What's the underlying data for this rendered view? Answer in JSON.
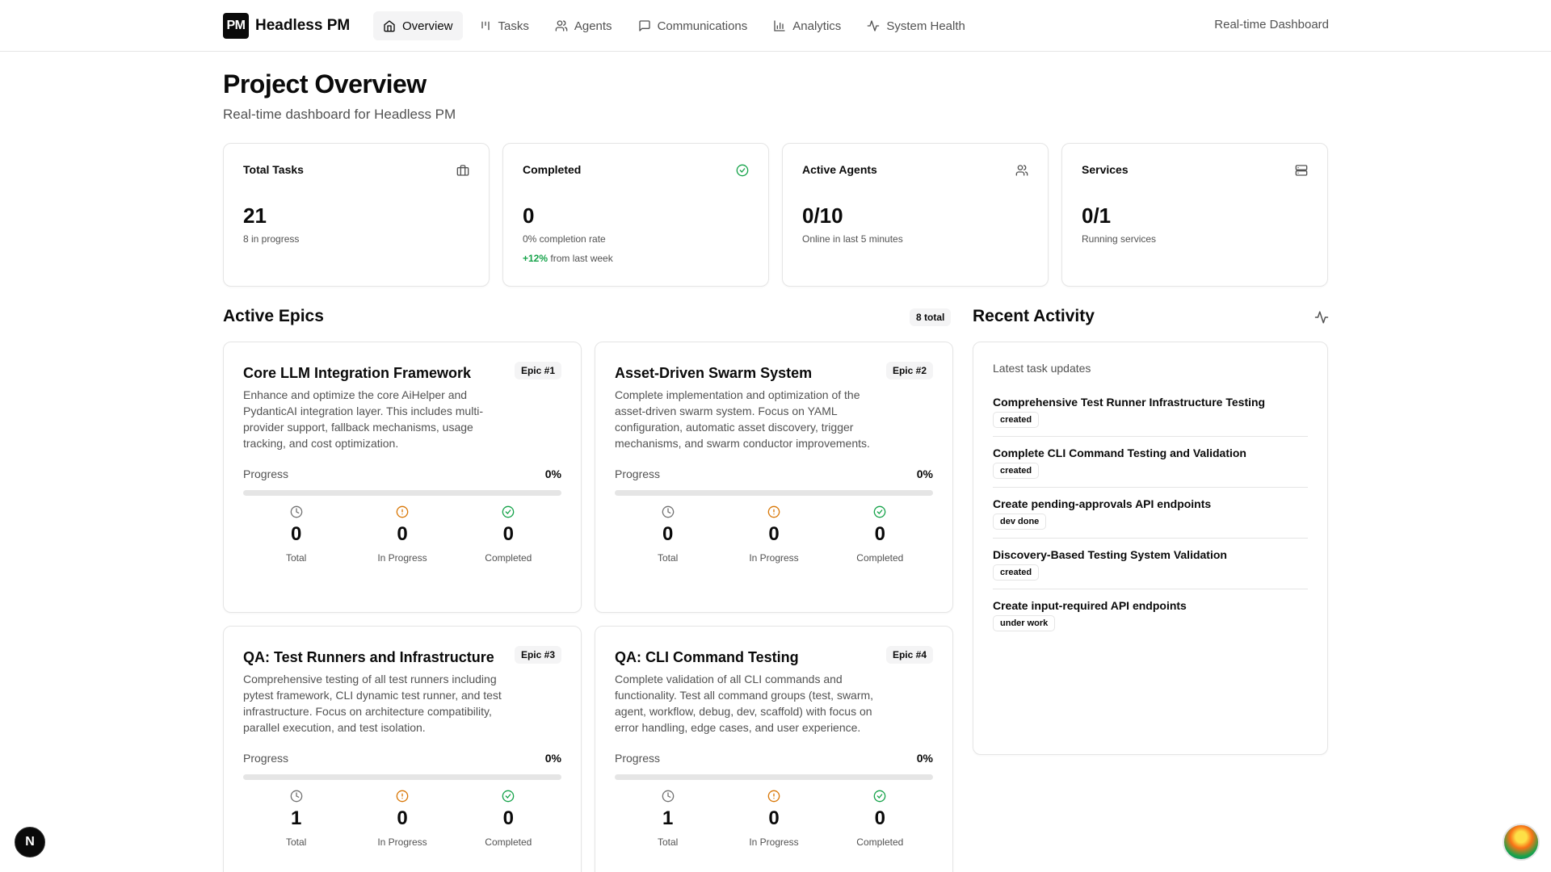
{
  "brand": {
    "logo": "PM",
    "name": "Headless PM"
  },
  "nav": [
    {
      "label": "Overview",
      "icon": "home-icon",
      "active": true
    },
    {
      "label": "Tasks",
      "icon": "kanban-icon",
      "active": false
    },
    {
      "label": "Agents",
      "icon": "users-icon",
      "active": false
    },
    {
      "label": "Communications",
      "icon": "message-icon",
      "active": false
    },
    {
      "label": "Analytics",
      "icon": "bar-chart-icon",
      "active": false
    },
    {
      "label": "System Health",
      "icon": "activity-icon",
      "active": false
    }
  ],
  "topbar_right": "Real-time Dashboard",
  "page": {
    "title": "Project Overview",
    "subtitle": "Real-time dashboard for Headless PM"
  },
  "stats": [
    {
      "label": "Total Tasks",
      "icon": "briefcase-icon",
      "value": "21",
      "note": "8 in progress"
    },
    {
      "label": "Completed",
      "icon": "check-circle-icon",
      "value": "0",
      "note": "0% completion rate",
      "delta": "+12%",
      "delta_text": "from last week"
    },
    {
      "label": "Active Agents",
      "icon": "users-icon",
      "value": "0/10",
      "note": "Online in last 5 minutes"
    },
    {
      "label": "Services",
      "icon": "server-icon",
      "value": "0/1",
      "note": "Running services"
    }
  ],
  "epics_section": {
    "title": "Active Epics",
    "badge": "8 total"
  },
  "epics": [
    {
      "title": "Core LLM Integration Framework",
      "tag": "Epic #1",
      "description": "Enhance and optimize the core AiHelper and PydanticAI integration layer. This includes multi-provider support, fallback mechanisms, usage tracking, and cost optimization.",
      "progress_label": "Progress",
      "progress": "0%",
      "progress_value": 0,
      "total": "0",
      "in_progress": "0",
      "completed": "0",
      "total_label": "Total",
      "in_progress_label": "In Progress",
      "completed_label": "Completed"
    },
    {
      "title": "Asset-Driven Swarm System",
      "tag": "Epic #2",
      "description": "Complete implementation and optimization of the asset-driven swarm system. Focus on YAML configuration, automatic asset discovery, trigger mechanisms, and swarm conductor improvements.",
      "progress_label": "Progress",
      "progress": "0%",
      "progress_value": 0,
      "total": "0",
      "in_progress": "0",
      "completed": "0",
      "total_label": "Total",
      "in_progress_label": "In Progress",
      "completed_label": "Completed"
    },
    {
      "title": "QA: Test Runners and Infrastructure",
      "tag": "Epic #3",
      "description": "Comprehensive testing of all test runners including pytest framework, CLI dynamic test runner, and test infrastructure. Focus on architecture compatibility, parallel execution, and test isolation.",
      "progress_label": "Progress",
      "progress": "0%",
      "progress_value": 0,
      "total": "1",
      "in_progress": "0",
      "completed": "0",
      "total_label": "Total",
      "in_progress_label": "In Progress",
      "completed_label": "Completed"
    },
    {
      "title": "QA: CLI Command Testing",
      "tag": "Epic #4",
      "description": "Complete validation of all CLI commands and functionality. Test all command groups (test, swarm, agent, workflow, debug, dev, scaffold) with focus on error handling, edge cases, and user experience.",
      "progress_label": "Progress",
      "progress": "0%",
      "progress_value": 0,
      "total": "1",
      "in_progress": "0",
      "completed": "0",
      "total_label": "Total",
      "in_progress_label": "In Progress",
      "completed_label": "Completed"
    }
  ],
  "activity": {
    "title": "Recent Activity",
    "subtitle": "Latest task updates",
    "items": [
      {
        "title": "Comprehensive Test Runner Infrastructure Testing",
        "status": "created"
      },
      {
        "title": "Complete CLI Command Testing and Validation",
        "status": "created"
      },
      {
        "title": "Create pending-approvals API endpoints",
        "status": "dev done"
      },
      {
        "title": "Discovery-Based Testing System Validation",
        "status": "created"
      },
      {
        "title": "Create input-required API endpoints",
        "status": "under work"
      }
    ]
  },
  "floating": {
    "next_label": "N"
  },
  "colors": {
    "accent_green": "#16a34a",
    "warn_amber": "#d97706",
    "text_muted": "#525252",
    "border": "#e5e5e5"
  }
}
